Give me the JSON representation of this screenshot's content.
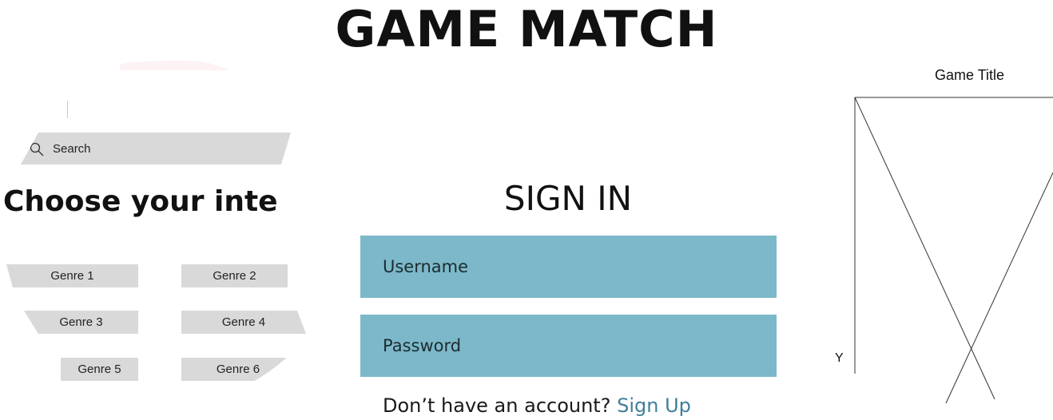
{
  "header": {
    "title": "GAME MATCH"
  },
  "interests_panel": {
    "search_placeholder": "Search",
    "heading": "Choose your interes",
    "genres": [
      "Genre 1",
      "Genre 2",
      "Genre 3",
      "Genre 4",
      "Genre 5",
      "Genre 6"
    ]
  },
  "signin": {
    "title": "SIGN IN",
    "username_label": "Username",
    "password_label": "Password",
    "no_account_text": "Don’t have an account?",
    "signup_link": "Sign Up"
  },
  "game_panel": {
    "title": "Game Title",
    "axis_label": "Y"
  },
  "colors": {
    "field_background": "#7cb8c9",
    "link": "#3f7f99",
    "chip_background": "#d9d9d9"
  },
  "icons": [
    "search-icon"
  ]
}
